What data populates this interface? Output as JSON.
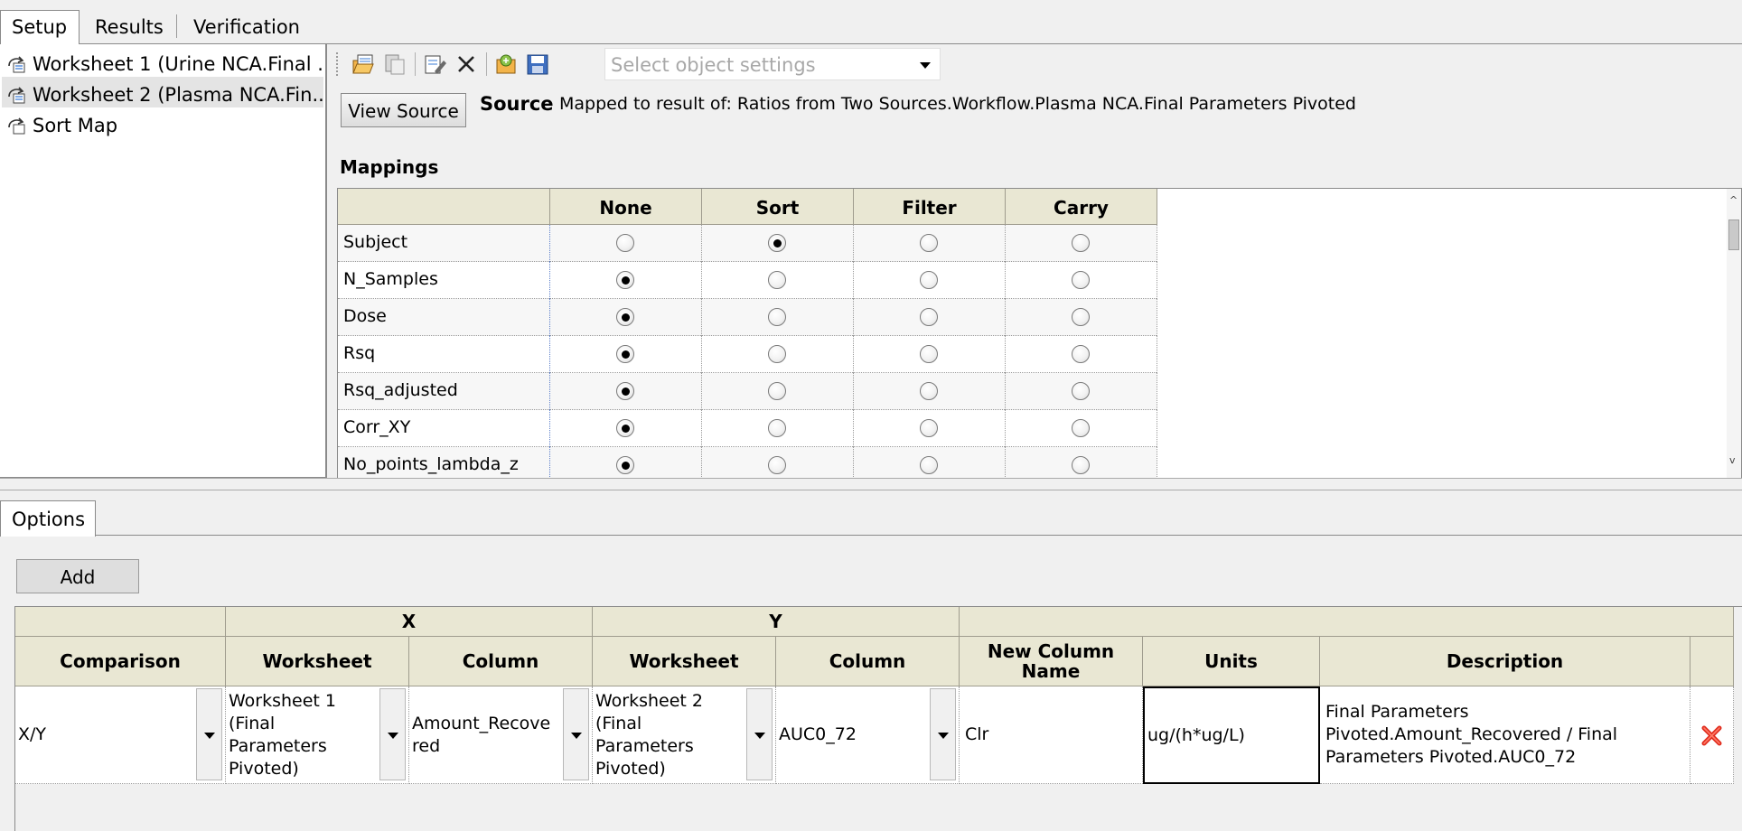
{
  "tabs": {
    "setup": "Setup",
    "results": "Results",
    "verification": "Verification"
  },
  "tree": {
    "items": [
      {
        "label": "Worksheet 1 (Urine NCA.Final ..."
      },
      {
        "label": "Worksheet 2 (Plasma NCA.Fin..."
      },
      {
        "label": "Sort Map"
      }
    ]
  },
  "toolbar": {
    "icons": [
      "open-icon",
      "paste-icon",
      "edit-icon",
      "delete-icon",
      "import-settings-icon",
      "save-settings-icon"
    ],
    "object_settings_placeholder": "Select object settings"
  },
  "source": {
    "view_button": "View Source",
    "label": "Source",
    "text": "Mapped to result of: Ratios from Two Sources.Workflow.Plasma NCA.Final Parameters Pivoted"
  },
  "mappings": {
    "title": "Mappings",
    "headers": [
      "None",
      "Sort",
      "Filter",
      "Carry"
    ],
    "rows": [
      {
        "name": "Subject",
        "selected": "Sort"
      },
      {
        "name": "N_Samples",
        "selected": "None"
      },
      {
        "name": "Dose",
        "selected": "None"
      },
      {
        "name": "Rsq",
        "selected": "None"
      },
      {
        "name": "Rsq_adjusted",
        "selected": "None"
      },
      {
        "name": "Corr_XY",
        "selected": "None"
      },
      {
        "name": "No_points_lambda_z",
        "selected": "None"
      }
    ]
  },
  "options": {
    "tab_label": "Options",
    "add_button": "Add",
    "group_x": "X",
    "group_y": "Y",
    "headers": {
      "comparison": "Comparison",
      "x_worksheet": "Worksheet",
      "x_column": "Column",
      "y_worksheet": "Worksheet",
      "y_column": "Column",
      "new_column_name": "New Column Name",
      "units": "Units",
      "description": "Description"
    },
    "row": {
      "comparison": "X/Y",
      "x_worksheet": "Worksheet 1 (Final Parameters Pivoted)",
      "x_column": "Amount_Recovered",
      "y_worksheet": "Worksheet 2 (Final Parameters Pivoted)",
      "y_column": "AUC0_72",
      "new_column_name": "Clr",
      "units": "ug/(h*ug/L)",
      "description": "Final Parameters Pivoted.Amount_Recovered / Final Parameters Pivoted.AUC0_72"
    }
  }
}
